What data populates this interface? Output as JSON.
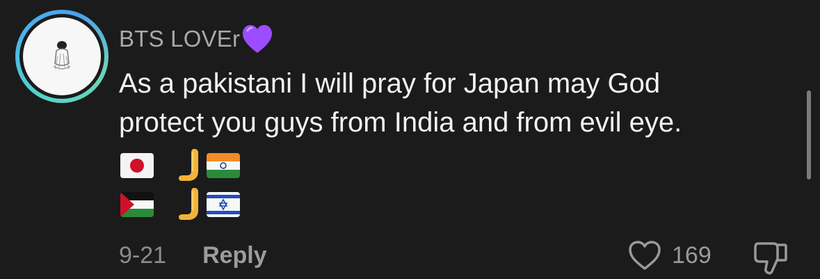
{
  "comment": {
    "username": "BTS LOVEr",
    "username_emoji": "purple-heart",
    "text_line1": "As a pakistani I will pray for Japan may God",
    "text_line2": "protect you guys from India and from evil eye.",
    "emoji_rows": [
      [
        "japan-flag",
        "palm-pushing-hand",
        "india-flag"
      ],
      [
        "palestine-flag",
        "palm-pushing-hand",
        "israel-flag"
      ]
    ],
    "date": "9-21",
    "reply_label": "Reply",
    "like_count": "169"
  },
  "colors": {
    "background": "#1b1b1b",
    "text": "#f2f2f2",
    "muted": "#a9a9a9",
    "avatar_ring": "#4bb6e8",
    "purple_heart": "#9b4dff"
  }
}
